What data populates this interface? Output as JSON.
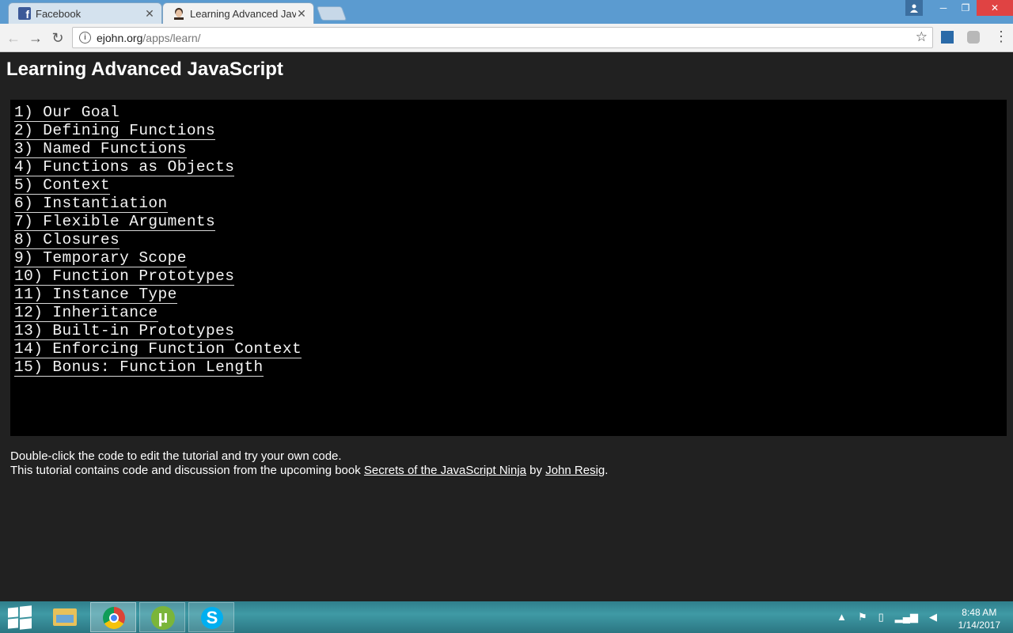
{
  "browser": {
    "tabs": [
      {
        "title": "Facebook",
        "active": false
      },
      {
        "title": "Learning Advanced JavaScript",
        "active": true
      }
    ],
    "url_domain": "ejohn.org",
    "url_path": "/apps/learn/"
  },
  "page": {
    "title": "Learning Advanced JavaScript",
    "lessons": [
      "1) Our Goal",
      "2) Defining Functions",
      "3) Named Functions",
      "4) Functions as Objects",
      "5) Context",
      "6) Instantiation",
      "7) Flexible Arguments",
      "8) Closures",
      "9) Temporary Scope",
      "10) Function Prototypes",
      "11) Instance Type",
      "12) Inheritance",
      "13) Built-in Prototypes",
      "14) Enforcing Function Context",
      "15) Bonus: Function Length"
    ],
    "footer_line1": "Double-click the code to edit the tutorial and try your own code.",
    "footer_line2_prefix": "This tutorial contains code and discussion from the upcoming book ",
    "book_link": "Secrets of the JavaScript Ninja",
    "by_text": " by ",
    "author_link": "John Resig",
    "period": "."
  },
  "taskbar": {
    "time": "8:48 AM",
    "date": "1/14/2017"
  },
  "colors": {
    "page_background": "#212121",
    "code_panel": "#000000",
    "tabstrip": "#5b9bd0"
  }
}
